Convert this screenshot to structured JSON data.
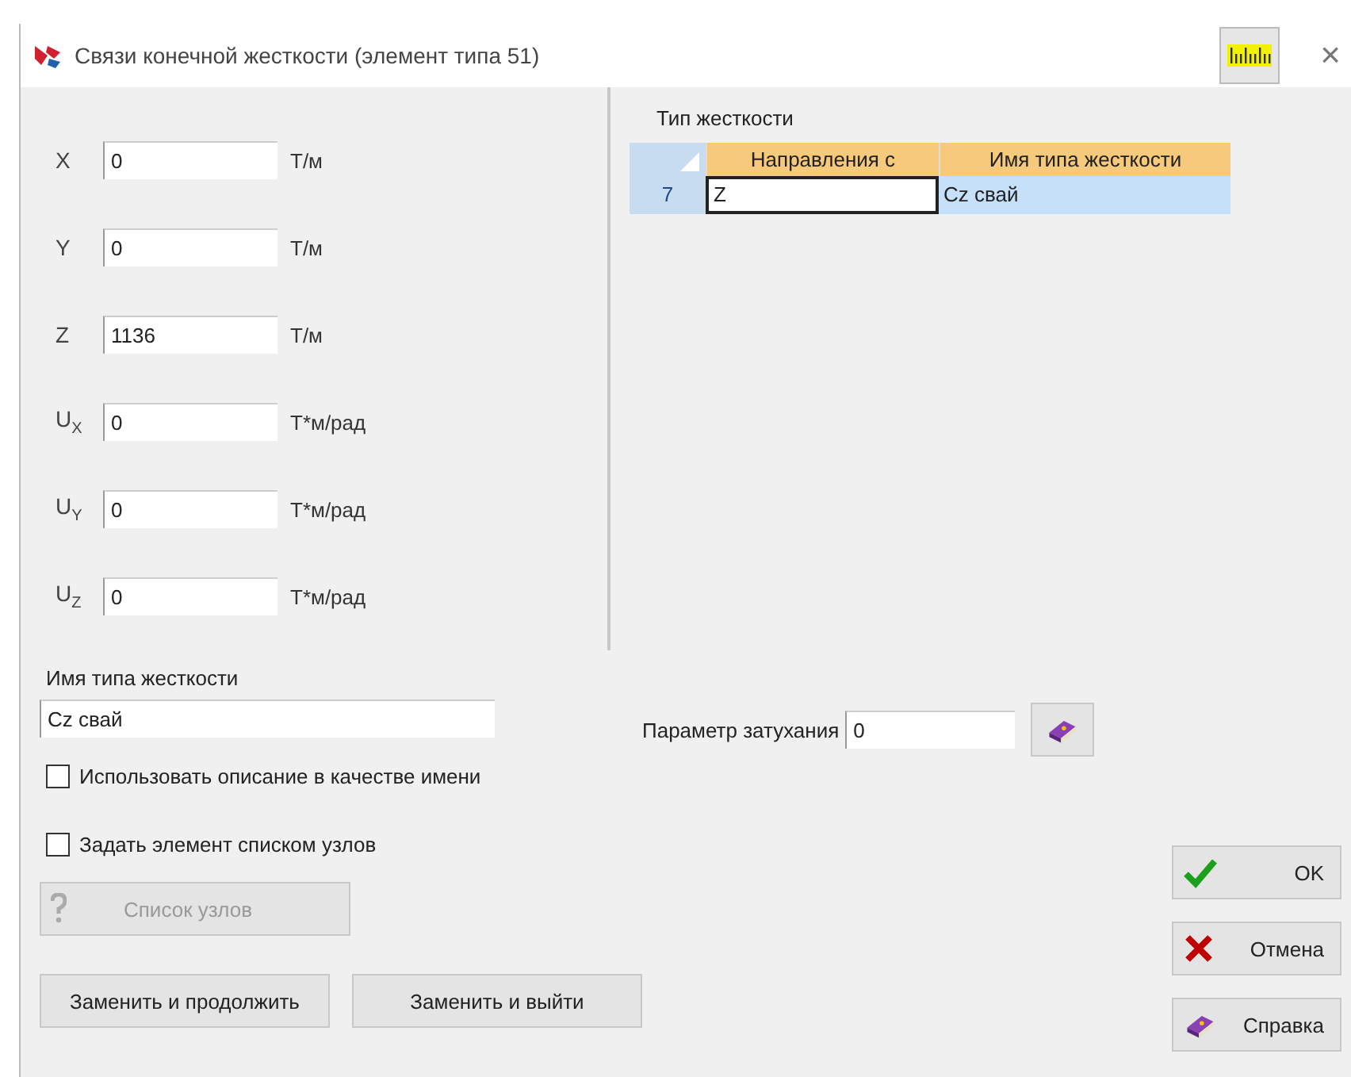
{
  "window": {
    "title": "Связи конечной жесткости (элемент типа 51)",
    "close": "×"
  },
  "fields": [
    {
      "label": "X",
      "value": "0",
      "unit": "Т/м"
    },
    {
      "label": "Y",
      "value": "0",
      "unit": "Т/м"
    },
    {
      "label": "Z",
      "value": "1136",
      "unit": "Т/м"
    },
    {
      "label": "U$_{X}$",
      "value": "0",
      "unit": "Т*м/рад"
    },
    {
      "label": "U$_{Y}$",
      "value": "0",
      "unit": "Т*м/рад"
    },
    {
      "label": "U$_{Z}$",
      "value": "0",
      "unit": "Т*м/рад"
    }
  ],
  "stiffness_table": {
    "title": "Тип жесткости",
    "columns": [
      "Направления с",
      "Имя типа жесткости"
    ],
    "rows": [
      {
        "number": "7",
        "cells": [
          "Z",
          "Cz свай"
        ],
        "selected": true
      }
    ]
  },
  "name": {
    "label": "Имя типа жесткости",
    "value": "Cz свай"
  },
  "damping": {
    "label": "Параметр затухания",
    "value": "0"
  },
  "checkboxes": [
    {
      "label": "Использовать описание в качестве имени",
      "checked": false
    },
    {
      "label": "Задать элемент списком узлов",
      "checked": false
    }
  ],
  "node_list_button": {
    "label": "Список узлов",
    "disabled": true
  },
  "bottom_buttons": [
    "Заменить и продолжить",
    "Заменить и выйти"
  ],
  "side_buttons": [
    {
      "kind": "ok",
      "label": "OK"
    },
    {
      "kind": "cancel",
      "label": "Отмена"
    },
    {
      "kind": "help",
      "label": "Справка"
    }
  ]
}
